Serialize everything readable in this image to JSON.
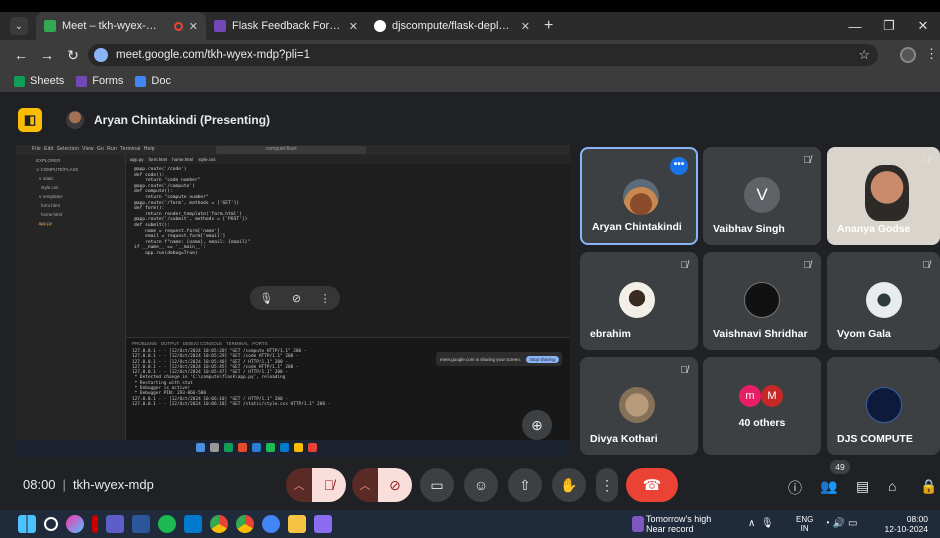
{
  "browser": {
    "tabs": [
      {
        "title": "Meet – tkh-wyex-mdp",
        "active": true
      },
      {
        "title": "Flask Feedback Form - Google",
        "active": false
      },
      {
        "title": "djscompute/flask-deployment",
        "active": false
      }
    ],
    "url": "meet.google.com/tkh-wyex-mdp?pli=1",
    "bookmarks": [
      "Sheets",
      "Forms",
      "Doc"
    ]
  },
  "meet": {
    "presenter_label": "Aryan Chintakindi (Presenting)",
    "meeting_time": "08:00",
    "meeting_code": "tkh-wyex-mdp",
    "people_count": "49",
    "participants": [
      {
        "name": "Aryan Chintakindi"
      },
      {
        "name": "Vaibhav Singh",
        "initial": "V"
      },
      {
        "name": "Ananya Godse"
      },
      {
        "name": "ebrahim"
      },
      {
        "name": "Vaishnavi Shridhar"
      },
      {
        "name": "Vyom Gala"
      },
      {
        "name": "Divya Kothari"
      },
      {
        "name": "40 others",
        "initials": [
          "m",
          "M"
        ]
      },
      {
        "name": "DJS COMPUTE"
      }
    ]
  },
  "shared_screen": {
    "code_lines": [
      "@app.route('/code')",
      "def code():",
      "    return \"code number\"",
      "",
      "@app.route('/compute')",
      "def compute():",
      "    return \"compute number\"",
      "",
      "@app.route('/form', methods = ['GET'])",
      "def form():",
      "    return render_template('form.html')",
      "",
      "@app.route('/submit', methods = ['POST'])",
      "def submit():",
      "    name = request.form['name']",
      "    email = request.form['email']",
      "    return f\"name: {name}, email: {email}\"",
      "",
      "if __name__ == '__main__':",
      "    app.run(debug=True)"
    ],
    "terminal_lines": [
      "127.0.0.1 - - [12/Oct/2024 10:05:20] \"GET /compute HTTP/1.1\" 200 -",
      "127.0.0.1 - - [12/Oct/2024 10:05:29] \"GET /code HTTP/1.1\" 200 -",
      "127.0.0.1 - - [12/Oct/2024 10:05:40] \"GET / HTTP/1.1\" 200 -",
      "127.0.0.1 - - [12/Oct/2024 10:05:45] \"GET /code HTTP/1.1\" 200 -",
      "127.0.0.1 - - [12/Oct/2024 10:05:47] \"GET / HTTP/1.1\" 200 -",
      " * Detected change in 'C:\\compute\\flask\\app.py', reloading",
      " * Restarting with stat",
      " * Debugger is active!",
      " * Debugger PIN: 293-866-580",
      "127.0.0.1 - - [12/Oct/2024 10:06:10] \"GET / HTTP/1.1\" 200 -",
      "127.0.0.1 - - [12/Oct/2024 10:06:18] \"GET /static/style.css HTTP/1.1\" 200 -"
    ],
    "share_notice": "meet.google.com is sharing your screen.",
    "stop_sharing": "Stop sharing"
  },
  "taskbar": {
    "weather_title": "Tomorrow's high",
    "weather_sub": "Near record",
    "lang_top": "ENG",
    "lang_bottom": "IN",
    "time": "08:00",
    "date": "12-10-2024"
  }
}
